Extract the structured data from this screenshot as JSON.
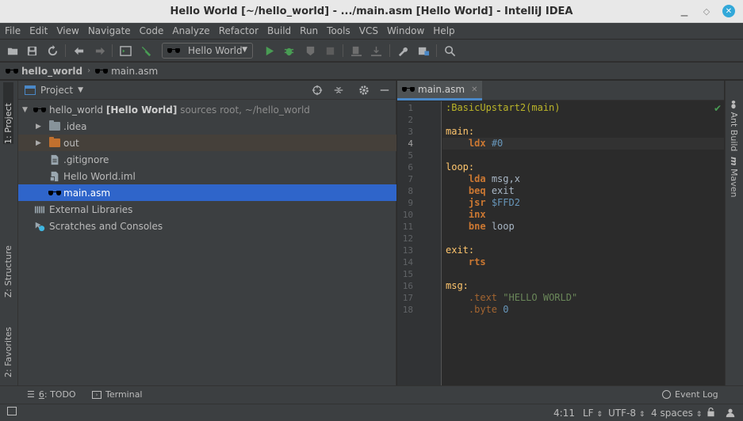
{
  "window": {
    "title": "Hello World [~/hello_world] - .../main.asm [Hello World] - IntelliJ IDEA"
  },
  "menu": [
    "File",
    "Edit",
    "View",
    "Navigate",
    "Code",
    "Analyze",
    "Refactor",
    "Build",
    "Run",
    "Tools",
    "VCS",
    "Window",
    "Help"
  ],
  "toolbar": {
    "run_config": "Hello World"
  },
  "breadcrumbs": [
    "hello_world",
    "main.asm"
  ],
  "left_tabs": [
    "1: Project",
    "Z: Structure",
    "2: Favorites"
  ],
  "right_tabs": [
    "Ant Build",
    "Maven"
  ],
  "project_panel": {
    "title": "Project",
    "root": {
      "name": "hello_world",
      "module": "[Hello World]",
      "suffix": "sources root, ~/hello_world"
    },
    "items": [
      ".idea",
      "out",
      ".gitignore",
      "Hello World.iml",
      "main.asm"
    ],
    "external_libraries": "External Libraries",
    "scratches": "Scratches and Consoles"
  },
  "editor": {
    "tab": "main.asm",
    "line_numbers": [
      "1",
      "2",
      "3",
      "4",
      "5",
      "6",
      "7",
      "8",
      "9",
      "10",
      "11",
      "12",
      "13",
      "14",
      "15",
      "16",
      "17",
      "18"
    ],
    "current_line": "4",
    "code": {
      "l1": ":BasicUpstart2(main)",
      "l3": "main:",
      "l4_op": "ldx",
      "l4_arg": "#0",
      "l6": "loop:",
      "l7_op": "lda",
      "l7_arg": "msg,x",
      "l8_op": "beq",
      "l8_arg": "exit",
      "l9_op": "jsr",
      "l9_arg": "$FFD2",
      "l10_op": "inx",
      "l11_op": "bne",
      "l11_arg": "loop",
      "l13": "exit:",
      "l14_op": "rts",
      "l16": "msg:",
      "l17_dir": ".text",
      "l17_arg": "\"HELLO WORLD\"",
      "l18_dir": ".byte",
      "l18_arg": "0"
    }
  },
  "bottom_tools": {
    "todo_prefix": "6",
    "todo_suffix": ": TODO",
    "terminal": "Terminal",
    "event_log": "Event Log"
  },
  "status": {
    "position": "4:11",
    "line_sep": "LF",
    "encoding": "UTF-8",
    "indent": "4 spaces"
  },
  "colors": {
    "selection": "#2f65ca",
    "keyword": "#cc7832",
    "label": "#ffc66d",
    "number": "#6897bb",
    "string": "#6a8759"
  }
}
